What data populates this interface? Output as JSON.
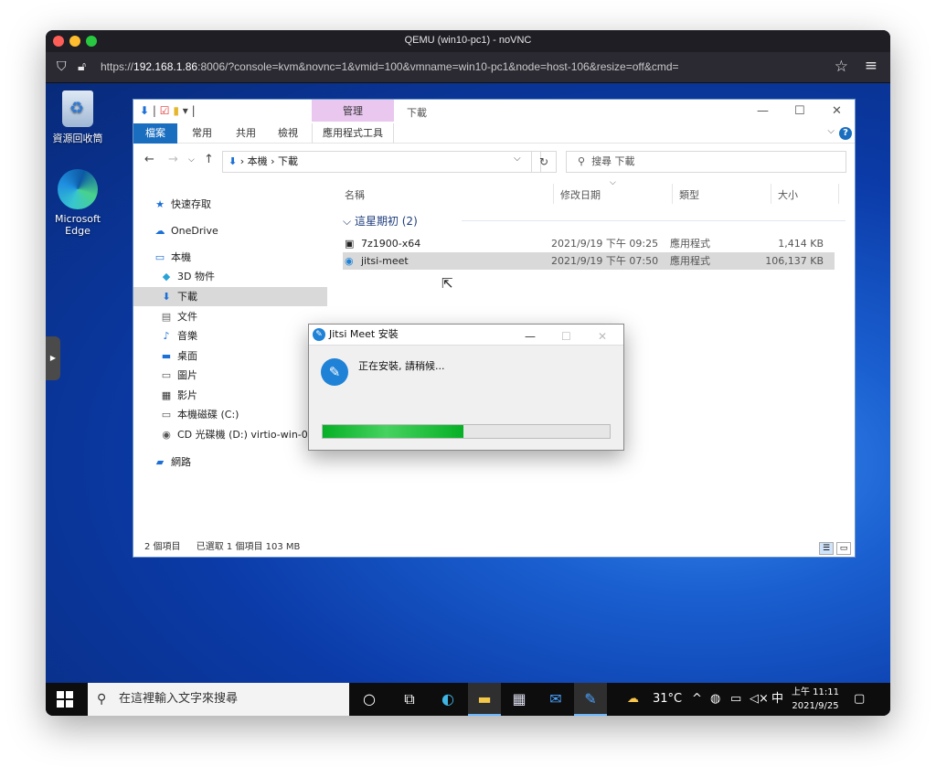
{
  "browser": {
    "title": "QEMU (win10-pc1) - noVNC",
    "url_prefix": "https://",
    "url_host": "192.168.1.86",
    "url_rest": ":8006/?console=kvm&novnc=1&vmid=100&vmname=win10-pc1&node=host-106&resize=off&cmd="
  },
  "desktop": {
    "recycle_bin": "資源回收筒",
    "edge_line1": "Microsoft",
    "edge_line2": "Edge"
  },
  "explorer": {
    "context_tab": "管理",
    "title": "下載",
    "ribbon_tabs": [
      "檔案",
      "常用",
      "共用",
      "檢視",
      "應用程式工具"
    ],
    "address": {
      "root": "本機",
      "sep1": "›",
      "folder": "下載"
    },
    "search_placeholder": "搜尋 下載",
    "nav": [
      {
        "label": "快速存取"
      },
      {
        "label": "OneDrive"
      },
      {
        "label": "本機"
      },
      {
        "label": "3D 物件"
      },
      {
        "label": "下載"
      },
      {
        "label": "文件"
      },
      {
        "label": "音樂"
      },
      {
        "label": "桌面"
      },
      {
        "label": "圖片"
      },
      {
        "label": "影片"
      },
      {
        "label": "本機磁碟 (C:)"
      },
      {
        "label": "CD 光碟機 (D:) virtio-win-0.1.1"
      },
      {
        "label": "網路"
      }
    ],
    "columns": [
      "名稱",
      "修改日期",
      "類型",
      "大小"
    ],
    "group": "這星期初 (2)",
    "files": [
      {
        "name": "7z1900-x64",
        "date": "2021/9/19 下午 09:25",
        "type": "應用程式",
        "size": "1,414 KB"
      },
      {
        "name": "jitsi-meet",
        "date": "2021/9/19 下午 07:50",
        "type": "應用程式",
        "size": "106,137 KB"
      }
    ],
    "status": {
      "count": "2 個項目",
      "selected": "已選取 1 個項目 103 MB"
    }
  },
  "installer": {
    "title": "Jitsi Meet 安裝",
    "message": "正在安裝, 請稍候...",
    "progress": 0.49
  },
  "taskbar": {
    "search_placeholder": "在這裡輸入文字來搜尋",
    "weather": "31°C",
    "ime": "中",
    "time": "上午 11:11",
    "date": "2021/9/25"
  },
  "colors": {
    "accent": "#1a6ec0",
    "progress_green": "#06b025",
    "context_tab": "#e9c7ef"
  }
}
